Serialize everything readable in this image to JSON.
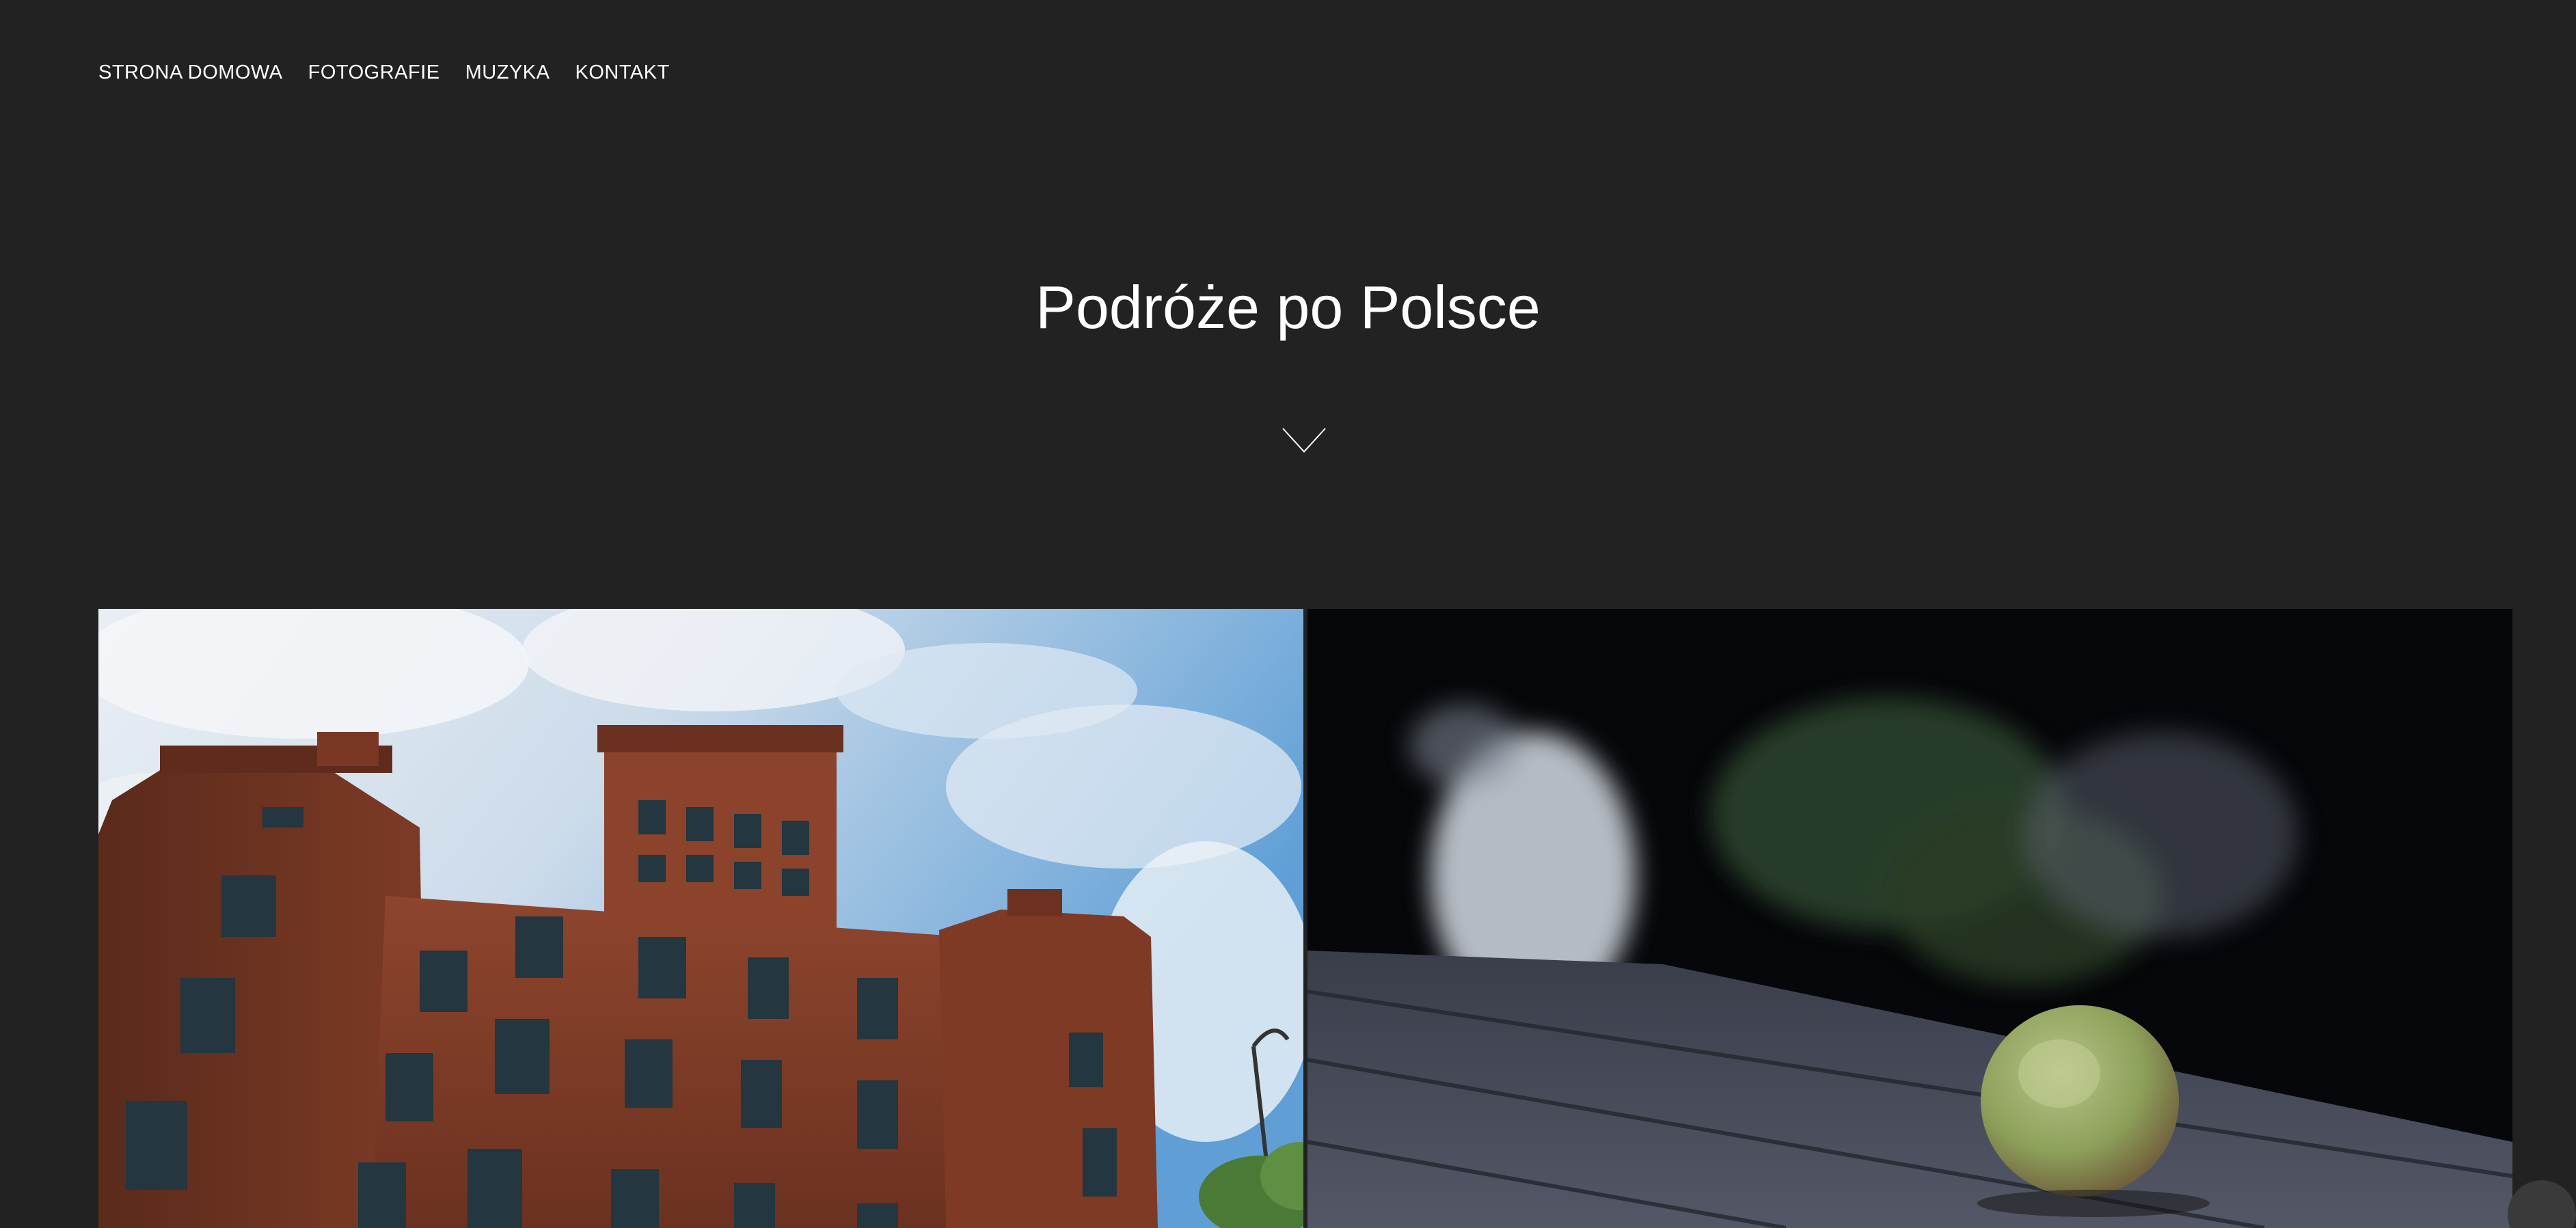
{
  "nav": {
    "items": [
      {
        "label": "STRONA DOMOWA"
      },
      {
        "label": "FOTOGRAFIE"
      },
      {
        "label": "MUZYKA"
      },
      {
        "label": "KONTAKT"
      }
    ]
  },
  "hero": {
    "title": "Podróże po Polsce",
    "scroll_icon": "chevron-down-icon"
  },
  "gallery": {
    "photos": [
      {
        "subject": "red-brick-factory-building"
      },
      {
        "subject": "green-apple-on-wooden-table"
      }
    ]
  },
  "colors": {
    "background": "#222222",
    "text": "#ffffff"
  }
}
